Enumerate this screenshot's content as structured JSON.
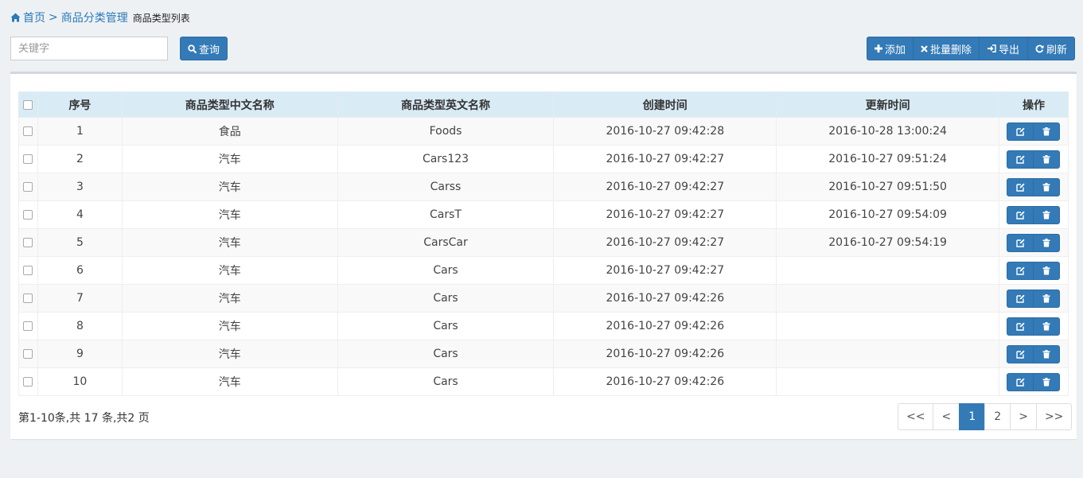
{
  "breadcrumb": {
    "home": "首页",
    "separator": ">",
    "section": "商品分类管理",
    "current": "商品类型列表"
  },
  "toolbar": {
    "search_placeholder": "关键字",
    "query_label": "查询",
    "add_label": "添加",
    "batch_delete_label": "批量删除",
    "export_label": "导出",
    "refresh_label": "刷新"
  },
  "table": {
    "headers": [
      "序号",
      "商品类型中文名称",
      "商品类型英文名称",
      "创建时间",
      "更新时间",
      "操作"
    ],
    "rows": [
      {
        "no": "1",
        "cn": "食品",
        "en": "Foods",
        "created": "2016-10-27 09:42:28",
        "updated": "2016-10-28 13:00:24"
      },
      {
        "no": "2",
        "cn": "汽车",
        "en": "Cars123",
        "created": "2016-10-27 09:42:27",
        "updated": "2016-10-27 09:51:24"
      },
      {
        "no": "3",
        "cn": "汽车",
        "en": "Carss",
        "created": "2016-10-27 09:42:27",
        "updated": "2016-10-27 09:51:50"
      },
      {
        "no": "4",
        "cn": "汽车",
        "en": "CarsT",
        "created": "2016-10-27 09:42:27",
        "updated": "2016-10-27 09:54:09"
      },
      {
        "no": "5",
        "cn": "汽车",
        "en": "CarsCar",
        "created": "2016-10-27 09:42:27",
        "updated": "2016-10-27 09:54:19"
      },
      {
        "no": "6",
        "cn": "汽车",
        "en": "Cars",
        "created": "2016-10-27 09:42:27",
        "updated": ""
      },
      {
        "no": "7",
        "cn": "汽车",
        "en": "Cars",
        "created": "2016-10-27 09:42:26",
        "updated": ""
      },
      {
        "no": "8",
        "cn": "汽车",
        "en": "Cars",
        "created": "2016-10-27 09:42:26",
        "updated": ""
      },
      {
        "no": "9",
        "cn": "汽车",
        "en": "Cars",
        "created": "2016-10-27 09:42:26",
        "updated": ""
      },
      {
        "no": "10",
        "cn": "汽车",
        "en": "Cars",
        "created": "2016-10-27 09:42:26",
        "updated": ""
      }
    ],
    "row_actions": [
      "edit-icon",
      "trash-icon"
    ]
  },
  "footer": {
    "page_info": "第1-10条,共 17 条,共2 页",
    "pages": [
      "<<",
      "<",
      "1",
      "2",
      ">",
      ">>"
    ],
    "active_page": "1"
  },
  "colors": {
    "primary": "#337ab7",
    "header_bg": "#d9ebf5",
    "link": "#2a7ab8",
    "page_bg": "#eef1f4"
  }
}
